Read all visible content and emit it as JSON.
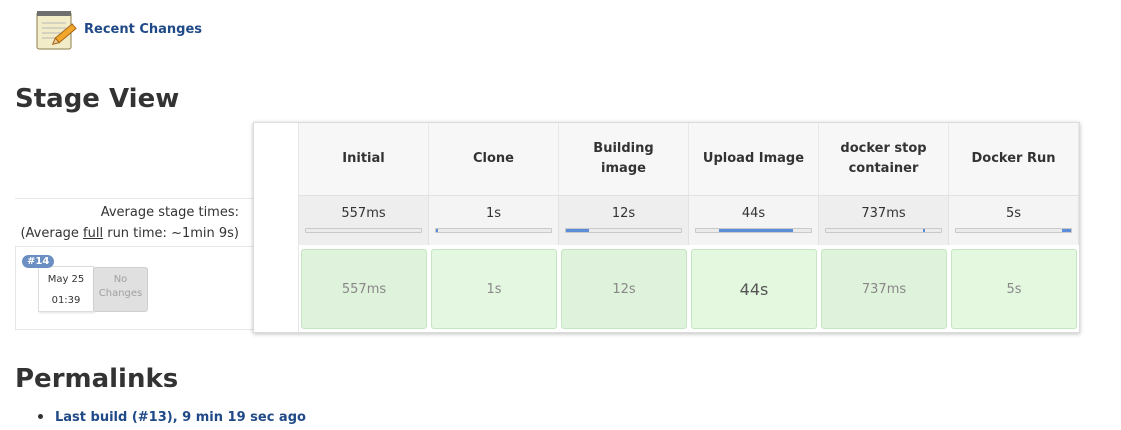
{
  "recent_changes": {
    "label": "Recent Changes"
  },
  "stage_view": {
    "title": "Stage View",
    "avg_line1": "Average stage times:",
    "avg_line2_pre": "(Average ",
    "avg_line2_link": "full",
    "avg_line2_post": " run time: ~1min 9s)",
    "build": {
      "number": "#14",
      "date": "May 25",
      "time": "01:39",
      "changes": "No Changes"
    },
    "stages": [
      {
        "name": "Initial",
        "avg": "557ms",
        "cell": "557ms",
        "bar": [
          0.0,
          0.0
        ],
        "cell_bg": "#dff2db"
      },
      {
        "name": "Clone",
        "avg": "1s",
        "cell": "1s",
        "bar": [
          0.0,
          0.02
        ],
        "cell_bg": "#e4f7e0"
      },
      {
        "name": "Building image",
        "avg": "12s",
        "cell": "12s",
        "bar": [
          0.0,
          0.2
        ],
        "cell_bg": "#dff2db"
      },
      {
        "name": "Upload Image",
        "avg": "44s",
        "cell": "44s",
        "bar": [
          0.2,
          0.84
        ],
        "cell_bg": "#e4f8e0"
      },
      {
        "name": "docker stop container",
        "avg": "737ms",
        "cell": "737ms",
        "bar": [
          0.84,
          0.86
        ],
        "cell_bg": "#dff2db"
      },
      {
        "name": "Docker Run",
        "avg": "5s",
        "cell": "5s",
        "bar": [
          0.92,
          1.0
        ],
        "cell_bg": "#e4f8e0"
      }
    ]
  },
  "permalinks": {
    "title": "Permalinks",
    "items": [
      {
        "label": "Last build (#13), 9 min 19 sec ago"
      }
    ]
  }
}
